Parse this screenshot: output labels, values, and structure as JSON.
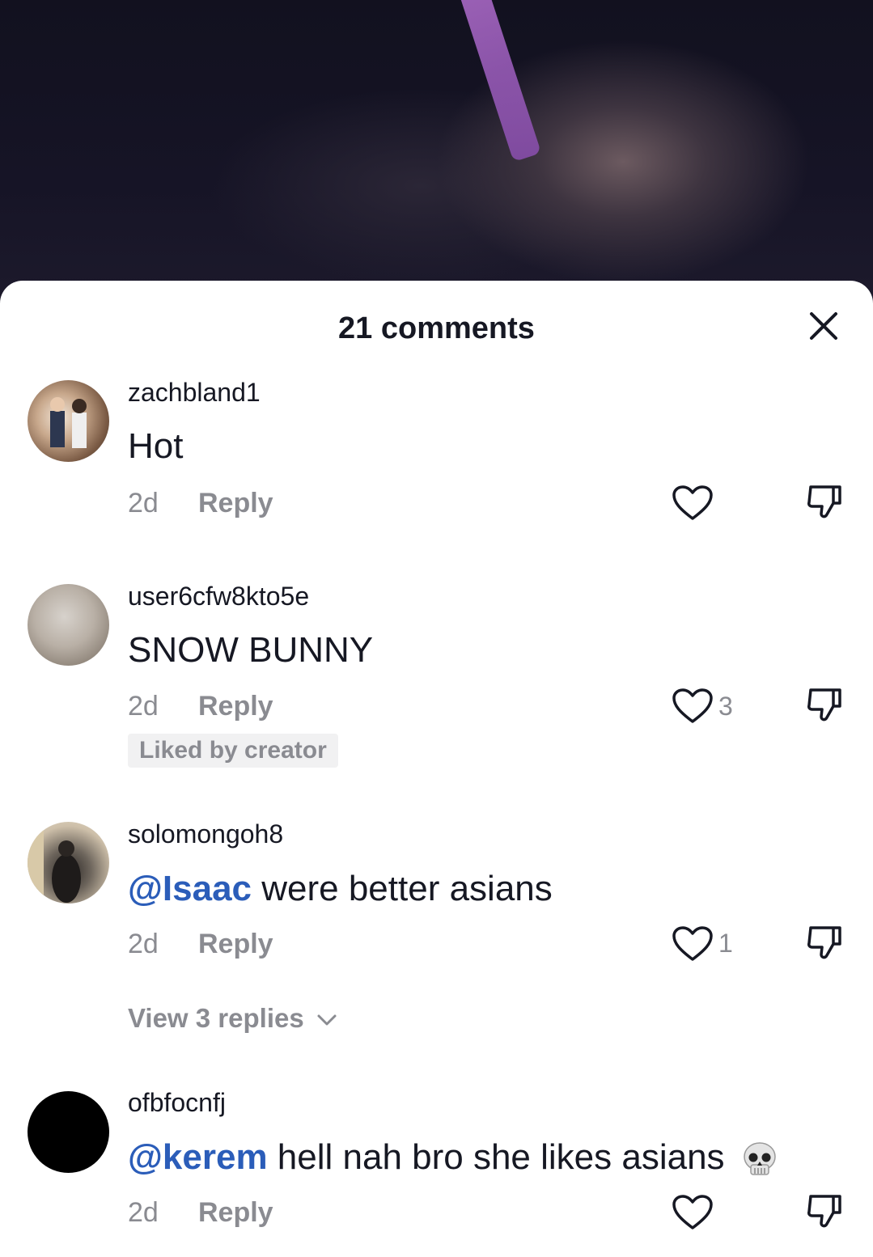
{
  "sheet": {
    "title": "21 comments",
    "close_icon": "close-icon"
  },
  "comments": [
    {
      "username": "zachbland1",
      "mention": "",
      "text": "Hot",
      "time": "2d",
      "reply_label": "Reply",
      "like_count": "",
      "badge": "",
      "view_replies": ""
    },
    {
      "username": "user6cfw8kto5e",
      "mention": "",
      "text": "SNOW BUNNY",
      "time": "2d",
      "reply_label": "Reply",
      "like_count": "3",
      "badge": "Liked by creator",
      "view_replies": ""
    },
    {
      "username": "solomongoh8",
      "mention": "@Isaac",
      "text": " were better asians",
      "time": "2d",
      "reply_label": "Reply",
      "like_count": "1",
      "badge": "",
      "view_replies": "View 3 replies"
    },
    {
      "username": "ofbfocnfj",
      "mention": "@kerem",
      "text": " hell nah bro she likes asians",
      "emoji": "skull-emoji",
      "time": "2d",
      "reply_label": "Reply",
      "like_count": "",
      "badge": "",
      "view_replies": ""
    }
  ],
  "colors": {
    "text": "#161823",
    "muted": "#8a8b91",
    "mention": "#2b5db9",
    "sheet_bg": "#ffffff"
  }
}
